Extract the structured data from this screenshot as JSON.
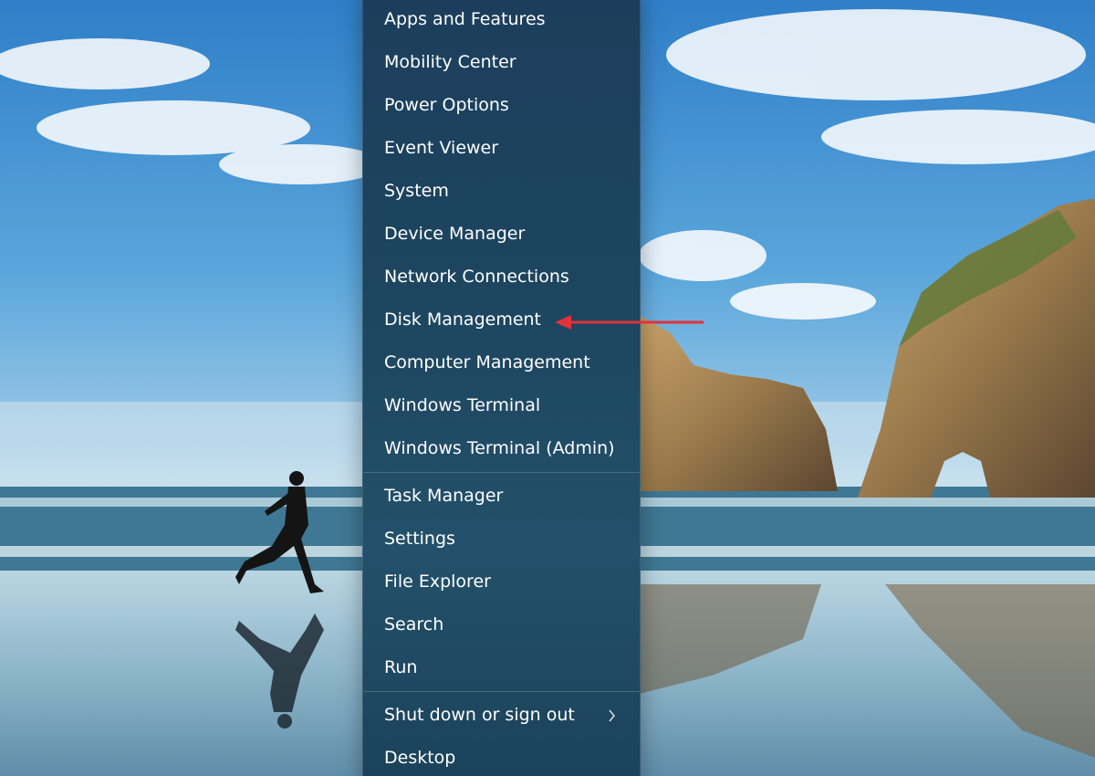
{
  "menu": {
    "group1": [
      {
        "id": "apps-and-features",
        "label": "Apps and Features"
      },
      {
        "id": "mobility-center",
        "label": "Mobility Center"
      },
      {
        "id": "power-options",
        "label": "Power Options"
      },
      {
        "id": "event-viewer",
        "label": "Event Viewer"
      },
      {
        "id": "system",
        "label": "System"
      },
      {
        "id": "device-manager",
        "label": "Device Manager"
      },
      {
        "id": "network-connections",
        "label": "Network Connections"
      },
      {
        "id": "disk-management",
        "label": "Disk Management"
      },
      {
        "id": "computer-management",
        "label": "Computer Management"
      },
      {
        "id": "windows-terminal",
        "label": "Windows Terminal"
      },
      {
        "id": "windows-terminal-admin",
        "label": "Windows Terminal (Admin)"
      }
    ],
    "group2": [
      {
        "id": "task-manager",
        "label": "Task Manager"
      },
      {
        "id": "settings",
        "label": "Settings"
      },
      {
        "id": "file-explorer",
        "label": "File Explorer"
      },
      {
        "id": "search",
        "label": "Search"
      },
      {
        "id": "run",
        "label": "Run"
      }
    ],
    "group3": [
      {
        "id": "shut-down-or-sign-out",
        "label": "Shut down or sign out",
        "submenu_icon": "chevron-right-icon"
      },
      {
        "id": "desktop",
        "label": "Desktop"
      }
    ]
  },
  "annotation": {
    "target": "Disk Management",
    "color": "#e0323a",
    "icon": "arrow-left-icon"
  },
  "colors": {
    "menu_bg": "#1d4660",
    "menu_text": "#ffffff",
    "sky": "#2f7fc8",
    "rock": "#9a7a4c"
  }
}
